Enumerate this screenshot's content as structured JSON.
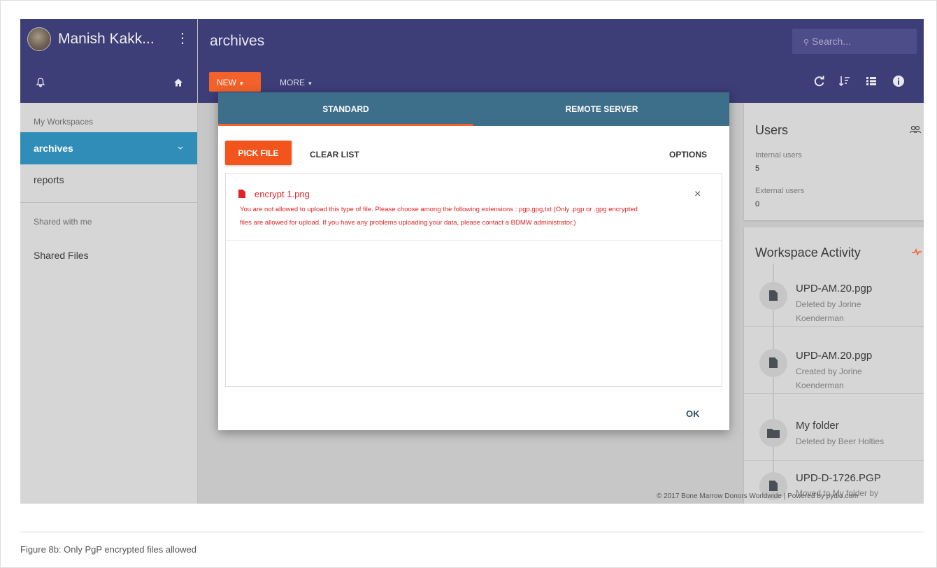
{
  "sidebar": {
    "user_name": "Manish Kakk...",
    "sections": {
      "my_workspaces": "My Workspaces",
      "shared_with_me": "Shared with me"
    },
    "workspaces": [
      {
        "label": "archives",
        "active": true
      },
      {
        "label": "reports",
        "active": false
      }
    ],
    "shared_items": [
      {
        "label": "Shared Files"
      }
    ],
    "icons": {
      "menu": "more-vert-icon",
      "bell": "bell-icon",
      "home": "home-icon",
      "chevron": "chevron-down-icon"
    }
  },
  "header": {
    "title": "archives",
    "search_placeholder": "Search...",
    "new_label": "NEW",
    "more_label": "MORE",
    "icons": [
      "refresh-icon",
      "sort-icon",
      "list-view-icon",
      "info-icon"
    ],
    "accent_color": "#f2622a",
    "bar_color": "#3d3d78"
  },
  "users_card": {
    "title": "Users",
    "internal_label": "Internal users",
    "internal_count": "5",
    "external_label": "External users",
    "external_count": "0"
  },
  "activity_card": {
    "title": "Workspace Activity",
    "items": [
      {
        "name": "UPD-AM.20.pgp",
        "desc": "Deleted by Jorine Koenderman",
        "icon": "file-icon"
      },
      {
        "name": "UPD-AM.20.pgp",
        "desc": "Created by Jorine Koenderman",
        "icon": "file-icon"
      },
      {
        "name": "My folder",
        "desc": "Deleted by Beer Holties",
        "icon": "folder-icon"
      },
      {
        "name": "UPD-D-1726.PGP",
        "desc": "Moved to My folder by",
        "icon": "file-icon"
      }
    ]
  },
  "footer": {
    "text": "© 2017 Bone Marrow Donors Worldwide | Powered by pydio.com"
  },
  "modal": {
    "tabs": [
      {
        "label": "STANDARD",
        "active": true
      },
      {
        "label": "REMOTE SERVER",
        "active": false
      }
    ],
    "pick_file": "PICK FILE",
    "clear_list": "CLEAR LIST",
    "options": "OPTIONS",
    "file": {
      "name": "encrypt 1.png",
      "error_line1": "You are not allowed to upload this type of file. Please choose among the following extensions : pgp,gpg,txt (Only .pgp or .gpg encrypted",
      "error_line2": "files are allowed for upload. If you have any problems uploading your data, please contact a BDMW administrator.)",
      "close": "×"
    },
    "ok": "OK",
    "error_color": "#e02424"
  },
  "caption": "Figure 8b: Only PgP encrypted files allowed"
}
